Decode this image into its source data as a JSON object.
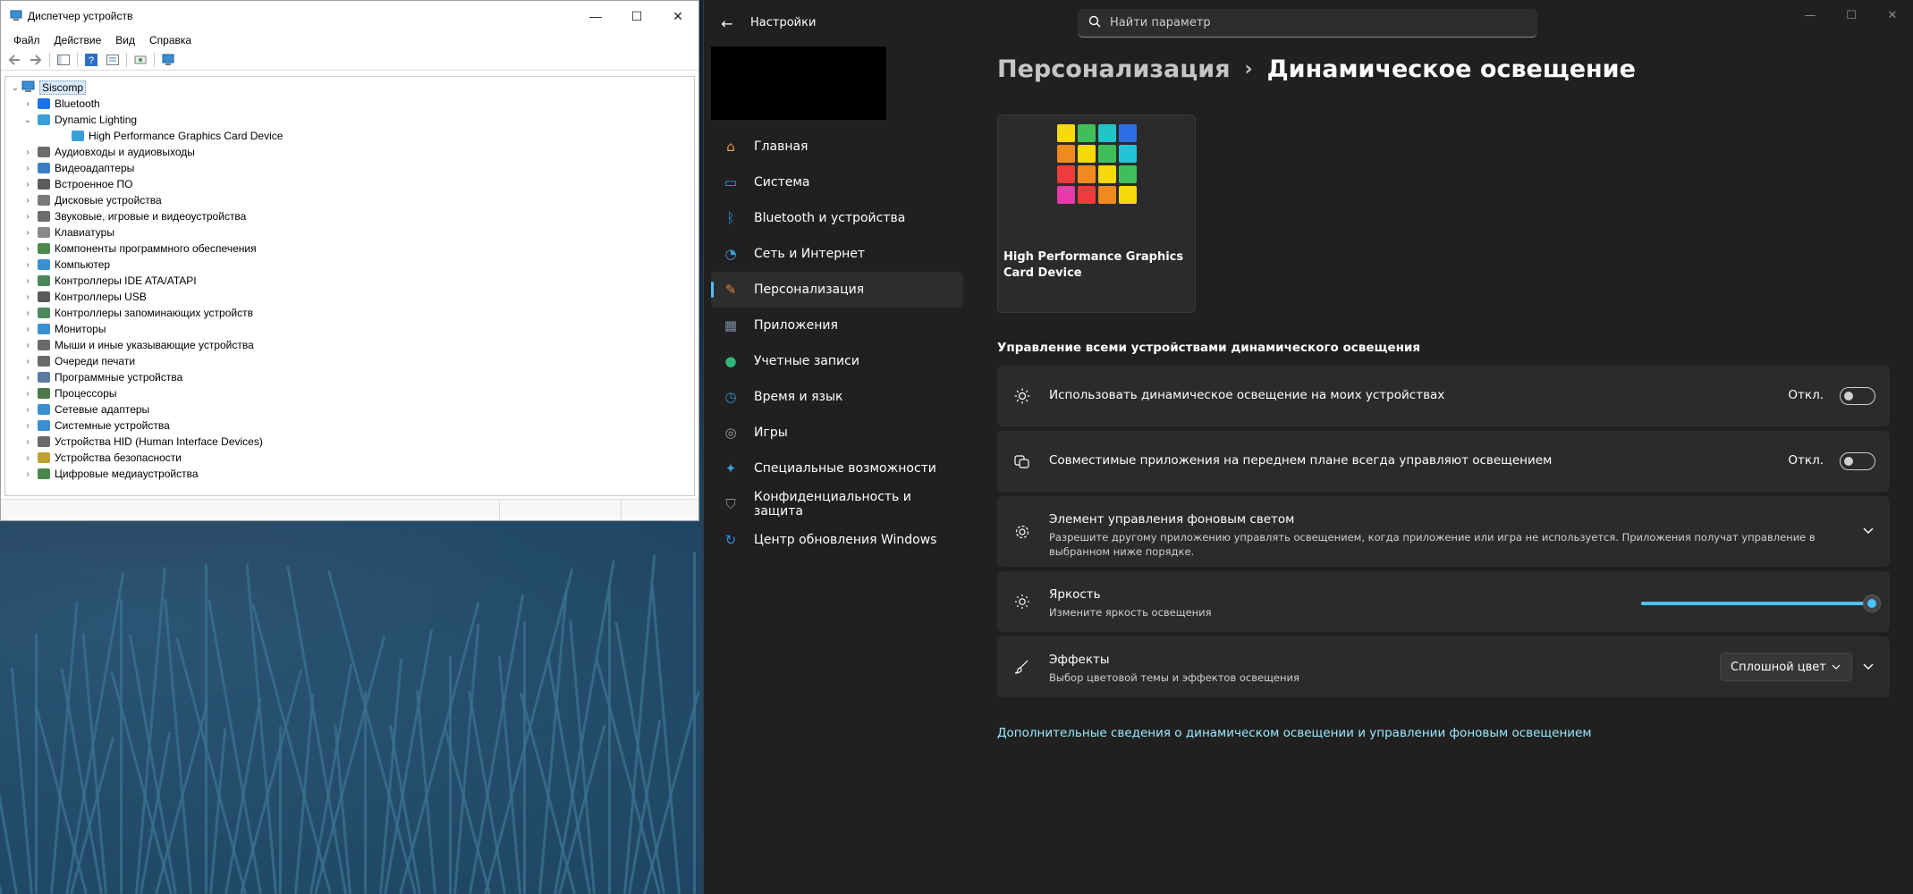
{
  "device_manager": {
    "title": "Диспетчер устройств",
    "menu": [
      "Файл",
      "Действие",
      "Вид",
      "Справка"
    ],
    "root": "Siscomp",
    "tree": [
      {
        "label": "Bluetooth",
        "level": 1,
        "expander": "›",
        "icon_color": "#1a73e8"
      },
      {
        "label": "Dynamic Lighting",
        "level": 1,
        "expander": "⌄",
        "icon_color": "#3aa0d8"
      },
      {
        "label": "High Performance Graphics Card Device",
        "level": 2,
        "expander": "",
        "icon_color": "#3aa0d8"
      },
      {
        "label": "Аудиовходы и аудиовыходы",
        "level": 1,
        "expander": "›",
        "icon_color": "#6c6c6c"
      },
      {
        "label": "Видеоадаптеры",
        "level": 1,
        "expander": "›",
        "icon_color": "#3a7fc4"
      },
      {
        "label": "Встроенное ПО",
        "level": 1,
        "expander": "›",
        "icon_color": "#5c5c5c"
      },
      {
        "label": "Дисковые устройства",
        "level": 1,
        "expander": "›",
        "icon_color": "#7a7a7a"
      },
      {
        "label": "Звуковые, игровые и видеоустройства",
        "level": 1,
        "expander": "›",
        "icon_color": "#6c6c6c"
      },
      {
        "label": "Клавиатуры",
        "level": 1,
        "expander": "›",
        "icon_color": "#8a8a8a"
      },
      {
        "label": "Компоненты программного обеспечения",
        "level": 1,
        "expander": "›",
        "icon_color": "#4a8a4a"
      },
      {
        "label": "Компьютер",
        "level": 1,
        "expander": "›",
        "icon_color": "#3a8fd0"
      },
      {
        "label": "Контроллеры IDE ATA/ATAPI",
        "level": 1,
        "expander": "›",
        "icon_color": "#4a8a5a"
      },
      {
        "label": "Контроллеры USB",
        "level": 1,
        "expander": "›",
        "icon_color": "#5a5a5a"
      },
      {
        "label": "Контроллеры запоминающих устройств",
        "level": 1,
        "expander": "›",
        "icon_color": "#4a8a5a"
      },
      {
        "label": "Мониторы",
        "level": 1,
        "expander": "›",
        "icon_color": "#3a8fd0"
      },
      {
        "label": "Мыши и иные указывающие устройства",
        "level": 1,
        "expander": "›",
        "icon_color": "#6a6a6a"
      },
      {
        "label": "Очереди печати",
        "level": 1,
        "expander": "›",
        "icon_color": "#6a6a6a"
      },
      {
        "label": "Программные устройства",
        "level": 1,
        "expander": "›",
        "icon_color": "#5a7aa0"
      },
      {
        "label": "Процессоры",
        "level": 1,
        "expander": "›",
        "icon_color": "#4a7a4a"
      },
      {
        "label": "Сетевые адаптеры",
        "level": 1,
        "expander": "›",
        "icon_color": "#3a8fd0"
      },
      {
        "label": "Системные устройства",
        "level": 1,
        "expander": "›",
        "icon_color": "#3a8fd0"
      },
      {
        "label": "Устройства HID (Human Interface Devices)",
        "level": 1,
        "expander": "›",
        "icon_color": "#6a6a6a"
      },
      {
        "label": "Устройства безопасности",
        "level": 1,
        "expander": "›",
        "icon_color": "#c0a030"
      },
      {
        "label": "Цифровые медиаустройства",
        "level": 1,
        "expander": "›",
        "icon_color": "#4a8a4a"
      }
    ]
  },
  "settings": {
    "app_title": "Настройки",
    "search_placeholder": "Найти параметр",
    "nav": [
      {
        "label": "Главная",
        "icon": "home-icon",
        "color": "#e8a24a",
        "glyph": "⌂"
      },
      {
        "label": "Система",
        "icon": "system-icon",
        "color": "#3aa0e0",
        "glyph": "▭"
      },
      {
        "label": "Bluetooth и устройства",
        "icon": "bluetooth-icon",
        "color": "#2f8fe6",
        "glyph": "ᛒ"
      },
      {
        "label": "Сеть и Интернет",
        "icon": "wifi-icon",
        "color": "#3aa0e0",
        "glyph": "◔"
      },
      {
        "label": "Персонализация",
        "icon": "brush-icon",
        "color": "#e08a3a",
        "glyph": "✎"
      },
      {
        "label": "Приложения",
        "icon": "apps-icon",
        "color": "#7a8aa0",
        "glyph": "▦"
      },
      {
        "label": "Учетные записи",
        "icon": "accounts-icon",
        "color": "#2fb87a",
        "glyph": "●"
      },
      {
        "label": "Время и язык",
        "icon": "time-language-icon",
        "color": "#3a8fd0",
        "glyph": "◷"
      },
      {
        "label": "Игры",
        "icon": "gaming-icon",
        "color": "#9aa0a8",
        "glyph": "◎"
      },
      {
        "label": "Специальные возможности",
        "icon": "accessibility-icon",
        "color": "#3aa0e0",
        "glyph": "✦"
      },
      {
        "label": "Конфиденциальность и защита",
        "icon": "shield-icon",
        "color": "#8a9098",
        "glyph": "⛉"
      },
      {
        "label": "Центр обновления Windows",
        "icon": "windows-update-icon",
        "color": "#2f8fe6",
        "glyph": "↻"
      }
    ],
    "active_nav_index": 4,
    "breadcrumb": {
      "parent": "Персонализация",
      "separator": "›",
      "current": "Динамическое освещение"
    },
    "device_card": {
      "name": "High Performance Graphics Card Device",
      "grid_colors": [
        "#f5d90a",
        "#3fbf5a",
        "#21c4c8",
        "#2f6fe6",
        "#f08a1e",
        "#f5d90a",
        "#3fbf5a",
        "#21c4d8",
        "#ef3b3b",
        "#f08a1e",
        "#f5d90a",
        "#3fbf5a",
        "#e83aa8",
        "#ef3b3b",
        "#f08a1e",
        "#f5d90a"
      ]
    },
    "section_header": "Управление всеми устройствами динамического освещения",
    "cards": {
      "use_dynamic": {
        "title": "Использовать динамическое освещение на моих устройствах",
        "state": "Откл."
      },
      "compatible_apps": {
        "title": "Совместимые приложения на переднем плане всегда управляют освещением",
        "state": "Откл."
      },
      "background_control": {
        "title": "Элемент управления фоновым светом",
        "subtitle": "Разрешите другому приложению управлять освещением, когда приложение или игра не используется. Приложения получат управление в выбранном ниже порядке."
      },
      "brightness": {
        "title": "Яркость",
        "subtitle": "Измените яркость освещения",
        "value": 100
      },
      "effects": {
        "title": "Эффекты",
        "subtitle": "Выбор цветовой темы и эффектов освещения",
        "selected": "Сплошной цвет"
      }
    },
    "more_link": "Дополнительные сведения о динамическом освещении и управлении фоновым освещением",
    "accent_color": "#4cc2ff"
  }
}
